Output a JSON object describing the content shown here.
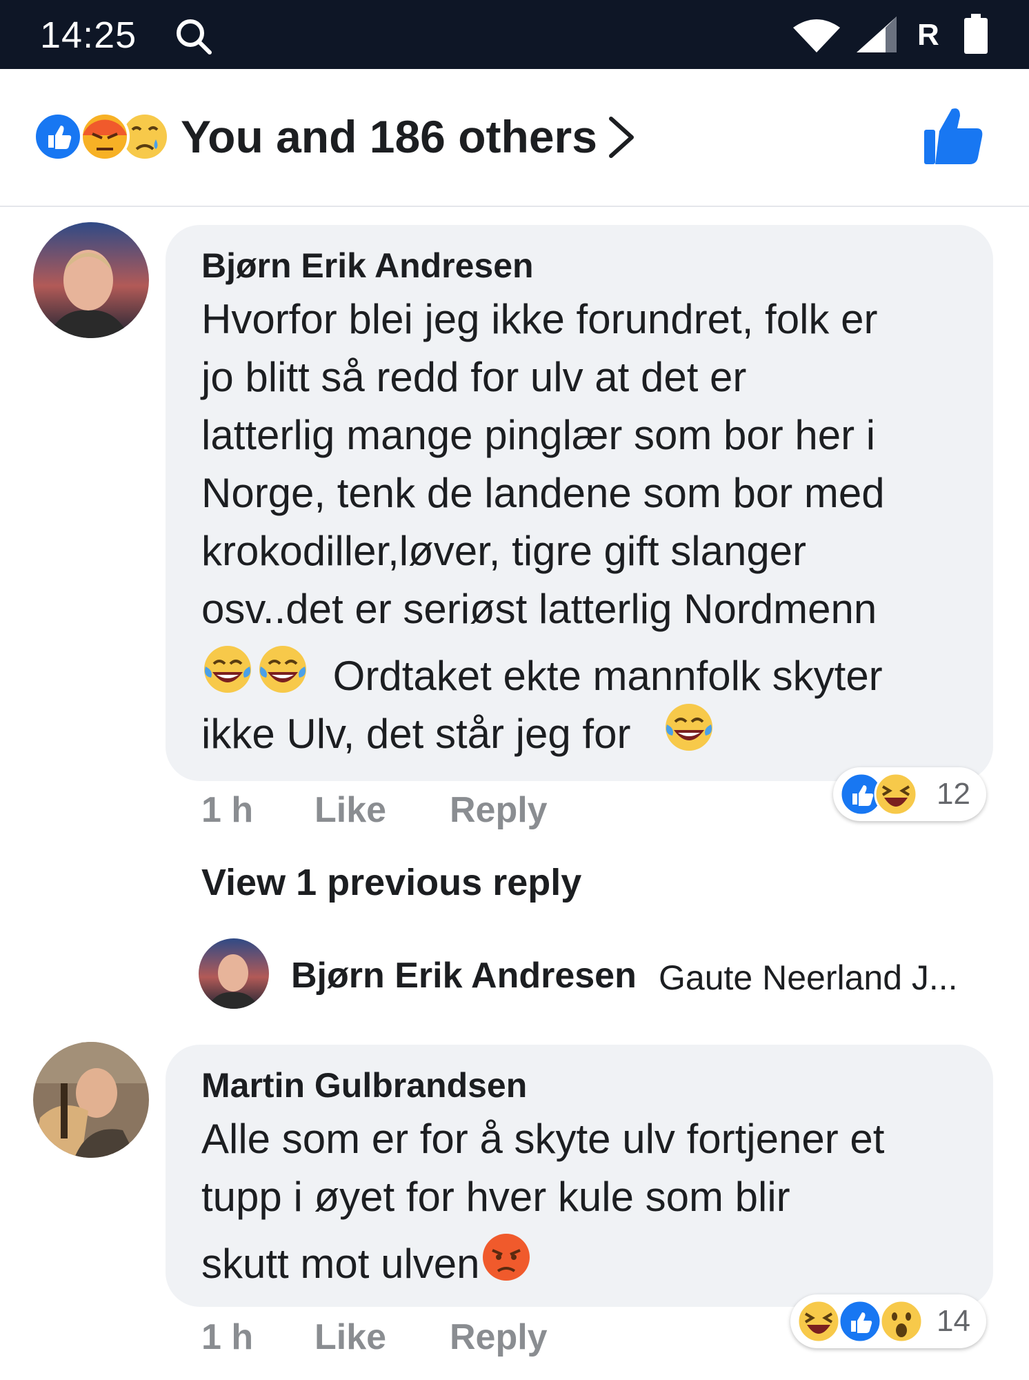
{
  "status_bar": {
    "time": "14:25",
    "network_letter": "R",
    "icons": [
      "search-icon",
      "wifi-icon",
      "signal-icon",
      "battery-icon"
    ]
  },
  "reactions_header": {
    "summary": "You and 186 others",
    "emojis": [
      "like",
      "angry",
      "sad"
    ]
  },
  "comments": [
    {
      "author": "Bjørn Erik Andresen",
      "lines": [
        "Hvorfor blei jeg ikke forundret, folk er",
        "jo blitt så redd for ulv at det er",
        "latterlig mange pinglær som bor her i",
        "Norge, tenk de landene som bor med",
        "krokodiller,løver, tigre gift slanger",
        "osv..det er seriøst latterlig Nordmenn",
        "Ordtaket ekte mannfolk skyter",
        "ikke Ulv, det står jeg for"
      ],
      "time": "1 h",
      "like_label": "Like",
      "reply_label": "Reply",
      "reaction_count": "12"
    },
    {
      "author": "Martin Gulbrandsen",
      "lines": [
        "Alle som er for å skyte ulv fortjener et",
        "tupp i øyet for hver kule som blir",
        "skutt mot ulven"
      ],
      "time": "1 h",
      "like_label": "Like",
      "reply_label": "Reply",
      "reaction_count": "14"
    }
  ],
  "view_previous": "View 1 previous reply",
  "reply_preview": {
    "author": "Bjørn Erik Andresen",
    "snippet": "Gaute Neerland J..."
  }
}
